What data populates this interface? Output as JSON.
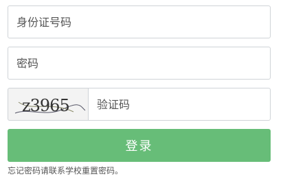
{
  "form": {
    "id_placeholder": "身份证号码",
    "password_placeholder": "密码",
    "captcha_text": "z3965",
    "captcha_placeholder": "验证码",
    "login_label": "登录",
    "hint": "忘记密码请联系学校重置密码。"
  },
  "colors": {
    "button": "#67bd78",
    "border": "#cfd3d7"
  }
}
